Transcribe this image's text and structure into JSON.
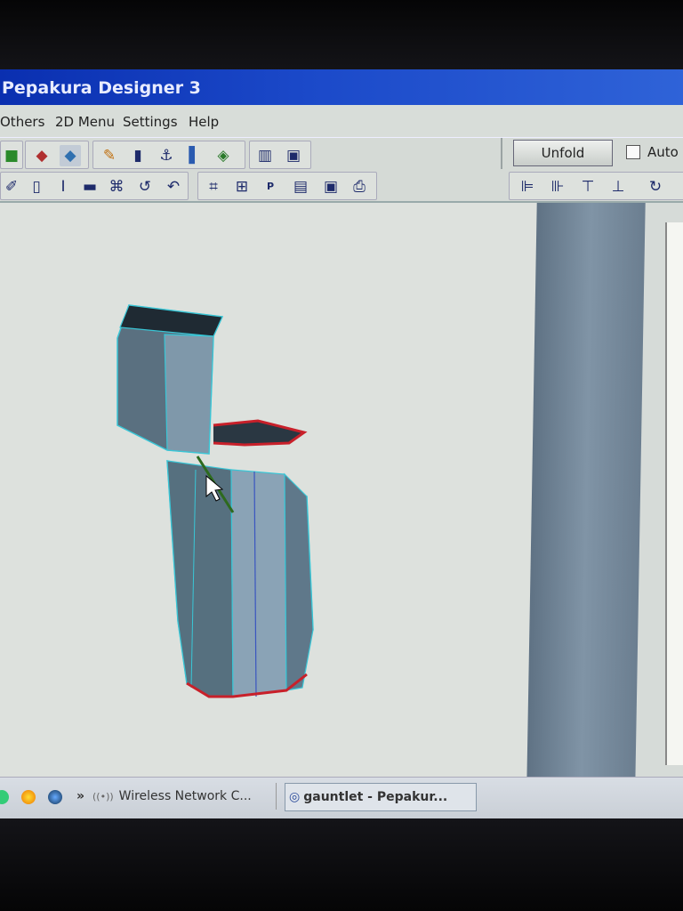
{
  "window": {
    "title": "Pepakura Designer 3"
  },
  "menu": {
    "items": [
      "Others",
      "2D Menu",
      "Settings",
      "Help"
    ]
  },
  "toolbar": {
    "unfold_label": "Unfold",
    "auto_label": "Auto",
    "auto_checked": false
  },
  "taskbar": {
    "chevron": "»",
    "items": [
      {
        "label": "Wireless Network C...",
        "icon": "wireless-network-icon"
      },
      {
        "label": "gauntlet - Pepakur...",
        "icon": "pepakura-app-icon"
      }
    ]
  },
  "colors": {
    "titlebar": "#1b49c9",
    "edge_cut": "#c8202a",
    "edge_fold": "#39c6d6",
    "flap_line": "#2d6a1e",
    "model_face": "#6f8798"
  }
}
